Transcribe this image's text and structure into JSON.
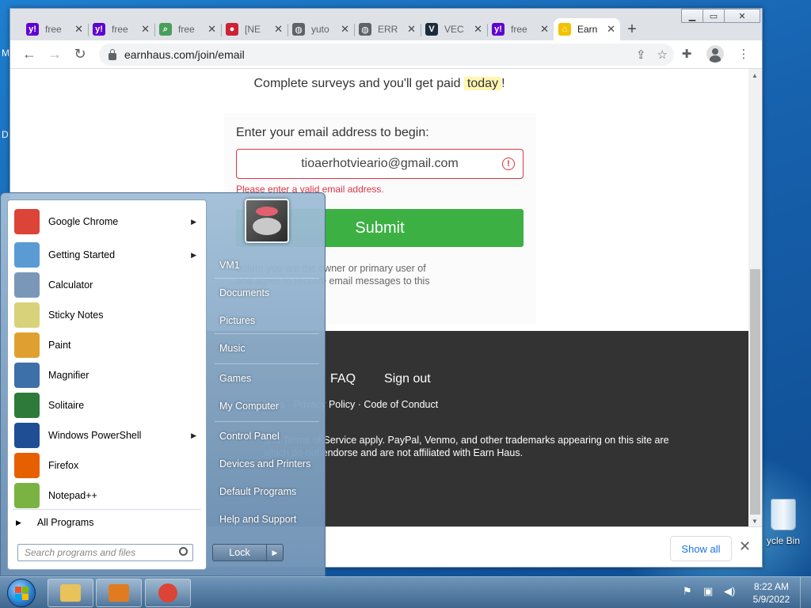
{
  "desktop": {
    "left_letters": [
      "M",
      "D"
    ],
    "recycle_bin_label": "ycle Bin"
  },
  "browser": {
    "tabs": [
      {
        "title": "free",
        "icon": "yahoo-icon",
        "color": "#6001d2",
        "glyph": "y!",
        "active": false
      },
      {
        "title": "free",
        "icon": "yahoo-icon",
        "color": "#6001d2",
        "glyph": "y!",
        "active": false
      },
      {
        "title": "free",
        "icon": "document-search-icon",
        "color": "#4a9d5b",
        "glyph": "⌕",
        "active": false
      },
      {
        "title": "[NE",
        "icon": "news-icon",
        "color": "#cc2233",
        "glyph": "●",
        "active": false
      },
      {
        "title": "yuto",
        "icon": "globe-icon",
        "color": "#5f6368",
        "glyph": "◍",
        "active": false
      },
      {
        "title": "ERR",
        "icon": "globe-icon",
        "color": "#5f6368",
        "glyph": "◍",
        "active": false
      },
      {
        "title": "VEC",
        "icon": "v-logo-icon",
        "color": "#1a2b3c",
        "glyph": "V",
        "active": false
      },
      {
        "title": "free",
        "icon": "yahoo-icon",
        "color": "#6001d2",
        "glyph": "y!",
        "active": false
      },
      {
        "title": "Earn",
        "icon": "earnhaus-home-icon",
        "color": "#f2c200",
        "glyph": "⌂",
        "active": true
      }
    ],
    "url": "earnhaus.com/join/email"
  },
  "page": {
    "headline_prefix": "Complete surveys and you'll get paid",
    "headline_highlight": "today",
    "headline_suffix": "!",
    "email_label": "Enter your email address to begin:",
    "email_value": "tioaerhotvieario@gmail.com",
    "email_error": "Please enter a valid email address.",
    "submit_label": "Submit",
    "consent_line1": "onfirm you are the owner or primary user of",
    "consent_line2": "and agree to receive email messages to this",
    "footer_links": [
      "FAQ",
      "Sign out"
    ],
    "legal_links": "tions · Privacy Policy · Code of Conduct",
    "tos_line1": "and Terms of Service apply. PayPal, Venmo, and other trademarks appearing on this site are",
    "tos_line2": "which do not endorse and are not affiliated with Earn Haus."
  },
  "downloads": {
    "show_all": "Show all"
  },
  "start_menu": {
    "programs": [
      {
        "label": "Google Chrome",
        "icon": "chrome-icon",
        "color": "#db4437",
        "submenu": true
      },
      {
        "label": "Getting Started",
        "icon": "getting-started-icon",
        "color": "#5a9bd4",
        "submenu": true
      },
      {
        "label": "Calculator",
        "icon": "calculator-icon",
        "color": "#7b97b8",
        "submenu": false
      },
      {
        "label": "Sticky Notes",
        "icon": "sticky-notes-icon",
        "color": "#d8d27a",
        "submenu": false
      },
      {
        "label": "Paint",
        "icon": "paint-icon",
        "color": "#e0a030",
        "submenu": false
      },
      {
        "label": "Magnifier",
        "icon": "magnifier-icon",
        "color": "#3d6fa8",
        "submenu": false
      },
      {
        "label": "Solitaire",
        "icon": "solitaire-icon",
        "color": "#2d7a3a",
        "submenu": false
      },
      {
        "label": "Windows PowerShell",
        "icon": "powershell-icon",
        "color": "#1f4e95",
        "submenu": true
      },
      {
        "label": "Firefox",
        "icon": "firefox-icon",
        "color": "#e66000",
        "submenu": false
      },
      {
        "label": "Notepad++",
        "icon": "notepadpp-icon",
        "color": "#7bb342",
        "submenu": false
      }
    ],
    "all_programs": "All Programs",
    "search_placeholder": "Search programs and files",
    "places": [
      "VM1",
      "Documents",
      "Pictures",
      "Music",
      "Games",
      "My Computer",
      "Control Panel",
      "Devices and Printers",
      "Default Programs",
      "Help and Support"
    ],
    "lock_label": "Lock"
  },
  "taskbar": {
    "pinned": [
      {
        "name": "explorer",
        "icon": "folder-icon",
        "color": "#e8c25a"
      },
      {
        "name": "media-player",
        "icon": "media-player-icon",
        "color": "#e07b20"
      },
      {
        "name": "chrome",
        "icon": "chrome-icon",
        "color": "#db4437"
      }
    ],
    "time": "8:22 AM",
    "date": "5/9/2022"
  }
}
